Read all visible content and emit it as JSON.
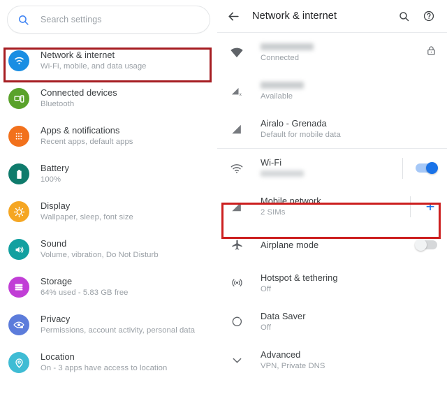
{
  "left_panel": {
    "search": {
      "placeholder": "Search settings",
      "icon": "search-icon"
    },
    "items": [
      {
        "title": "Network & internet",
        "subtitle": "Wi-Fi, mobile, and data usage",
        "icon": "wifi-icon",
        "color": "#1a8ee3",
        "highlighted": true
      },
      {
        "title": "Connected devices",
        "subtitle": "Bluetooth",
        "icon": "devices-icon",
        "color": "#5aa22b",
        "highlighted": false
      },
      {
        "title": "Apps & notifications",
        "subtitle": "Recent apps, default apps",
        "icon": "apps-grid-icon",
        "color": "#f2711c",
        "highlighted": false
      },
      {
        "title": "Battery",
        "subtitle": "100%",
        "icon": "battery-icon",
        "color": "#0f7b6c",
        "highlighted": false
      },
      {
        "title": "Display",
        "subtitle": "Wallpaper, sleep, font size",
        "icon": "brightness-icon",
        "color": "#f5a623",
        "highlighted": false
      },
      {
        "title": "Sound",
        "subtitle": "Volume, vibration, Do Not Disturb",
        "icon": "volume-icon",
        "color": "#12a0a0",
        "highlighted": false
      },
      {
        "title": "Storage",
        "subtitle": "64% used - 5.83 GB free",
        "icon": "storage-icon",
        "color": "#c13ed6",
        "highlighted": false
      },
      {
        "title": "Privacy",
        "subtitle": "Permissions, account activity, personal data",
        "icon": "privacy-eye-icon",
        "color": "#5c7cdb",
        "highlighted": false
      },
      {
        "title": "Location",
        "subtitle": "On - 3 apps have access to location",
        "icon": "location-pin-icon",
        "color": "#3fbcd4",
        "highlighted": false
      }
    ]
  },
  "right_panel": {
    "appbar": {
      "back_icon": "back-arrow-icon",
      "title": "Network & internet",
      "search_icon": "search-icon",
      "help_icon": "help-circle-icon"
    },
    "status_section": [
      {
        "title": "",
        "title_redacted": true,
        "subtitle": "Connected",
        "icon": "wifi-filled-icon",
        "trailing": "lock-icon"
      },
      {
        "title": "",
        "title_redacted": true,
        "subtitle": "Available",
        "icon": "signal-off-icon",
        "trailing": ""
      },
      {
        "title": "Airalo - Grenada",
        "title_redacted": false,
        "subtitle": "Default for mobile data",
        "icon": "signal-bars-icon",
        "trailing": ""
      }
    ],
    "settings_section": [
      {
        "title": "Wi-Fi",
        "subtitle": "",
        "subtitle_redacted": true,
        "icon": "wifi-outline-icon",
        "trailing": "toggle-on",
        "highlighted": false
      },
      {
        "title": "Mobile network",
        "subtitle": "2 SIMs",
        "subtitle_redacted": false,
        "icon": "signal-bars-icon",
        "trailing": "plus-icon",
        "highlighted": true
      },
      {
        "title": "Airplane mode",
        "subtitle": "",
        "subtitle_redacted": false,
        "icon": "airplane-icon",
        "trailing": "toggle-off",
        "highlighted": false
      },
      {
        "title": "Hotspot & tethering",
        "subtitle": "Off",
        "subtitle_redacted": false,
        "icon": "hotspot-icon",
        "trailing": "",
        "highlighted": false
      },
      {
        "title": "Data Saver",
        "subtitle": "Off",
        "subtitle_redacted": false,
        "icon": "data-saver-icon",
        "trailing": "",
        "highlighted": false
      },
      {
        "title": "Advanced",
        "subtitle": "VPN, Private DNS",
        "subtitle_redacted": false,
        "icon": "chevron-down-icon",
        "trailing": "",
        "highlighted": false
      }
    ]
  },
  "annotation": {
    "highlight_color_left": "#a61d22",
    "highlight_color_right": "#cc1f1f"
  }
}
